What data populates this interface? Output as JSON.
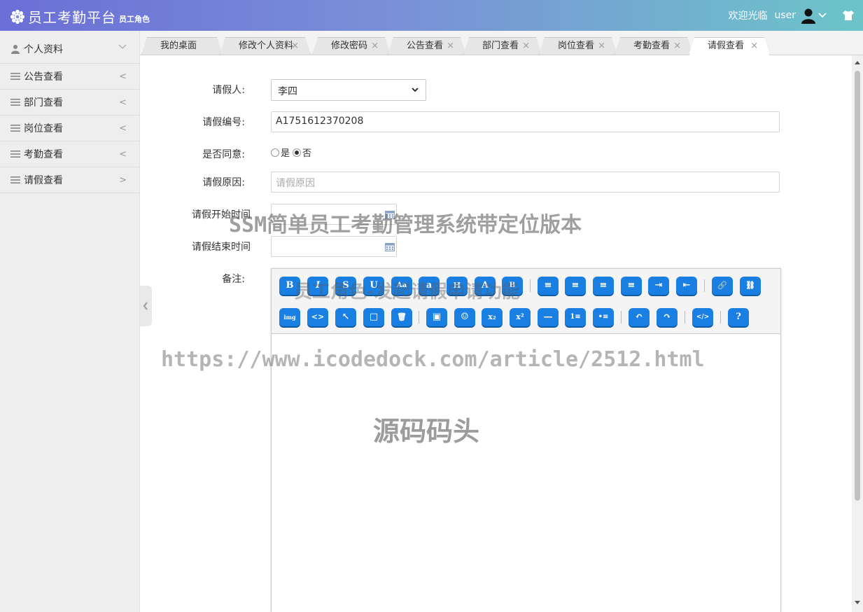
{
  "header": {
    "title": "员工考勤平台",
    "role": "员工角色",
    "welcome": "欢迎光临",
    "username": "user"
  },
  "sidebar": {
    "items": [
      {
        "label": "个人资料",
        "arrow": "⌵"
      },
      {
        "label": "公告查看",
        "arrow": "<"
      },
      {
        "label": "部门查看",
        "arrow": "<"
      },
      {
        "label": "岗位查看",
        "arrow": "<"
      },
      {
        "label": "考勤查看",
        "arrow": "<"
      },
      {
        "label": "请假查看",
        "arrow": ">"
      }
    ]
  },
  "tabs": [
    {
      "label": "我的桌面",
      "close": ""
    },
    {
      "label": "修改个人资料",
      "close": "×"
    },
    {
      "label": "修改密码",
      "close": "×"
    },
    {
      "label": "公告查看",
      "close": "×"
    },
    {
      "label": "部门查看",
      "close": "×"
    },
    {
      "label": "岗位查看",
      "close": "×"
    },
    {
      "label": "考勤查看",
      "close": "×"
    },
    {
      "label": "请假查看",
      "close": "×",
      "active": true
    }
  ],
  "form": {
    "applicant_label": "请假人:",
    "applicant_value": "李四",
    "leave_no_label": "请假编号:",
    "leave_no_value": "A1751612370208",
    "agree_label": "是否同意:",
    "agree_yes": "是",
    "agree_no": "否",
    "reason_label": "请假原因:",
    "reason_placeholder": "请假原因",
    "start_label": "请假开始时间",
    "end_label": "请假结束时间",
    "remark_label": "备注:"
  },
  "editor_buttons": {
    "row1": [
      "B",
      "I",
      "S",
      "U",
      "Aa",
      "a",
      "H",
      "A",
      "B",
      "≡",
      "≡",
      "≡",
      "≡",
      "⇥",
      "⇤",
      "🔗",
      "⛓"
    ],
    "row2": [
      "img",
      "<>",
      "↖",
      "□",
      "🗑",
      "▣",
      "☺",
      "x₂",
      "x²",
      "—",
      "1≡",
      "•≡",
      "↶",
      "↷",
      "</>",
      "?"
    ]
  },
  "watermarks": {
    "w1": "SSM简单员工考勤管理系统带定位版本",
    "w2": "员工角色-发起请假申请功能",
    "w3": "https://www.icodedock.com/article/2512.html",
    "w4": "源码码头"
  },
  "colors": {
    "header_start": "#6a6fd6",
    "header_end": "#6cc5c9",
    "editor_button": "#1a7fe3"
  }
}
